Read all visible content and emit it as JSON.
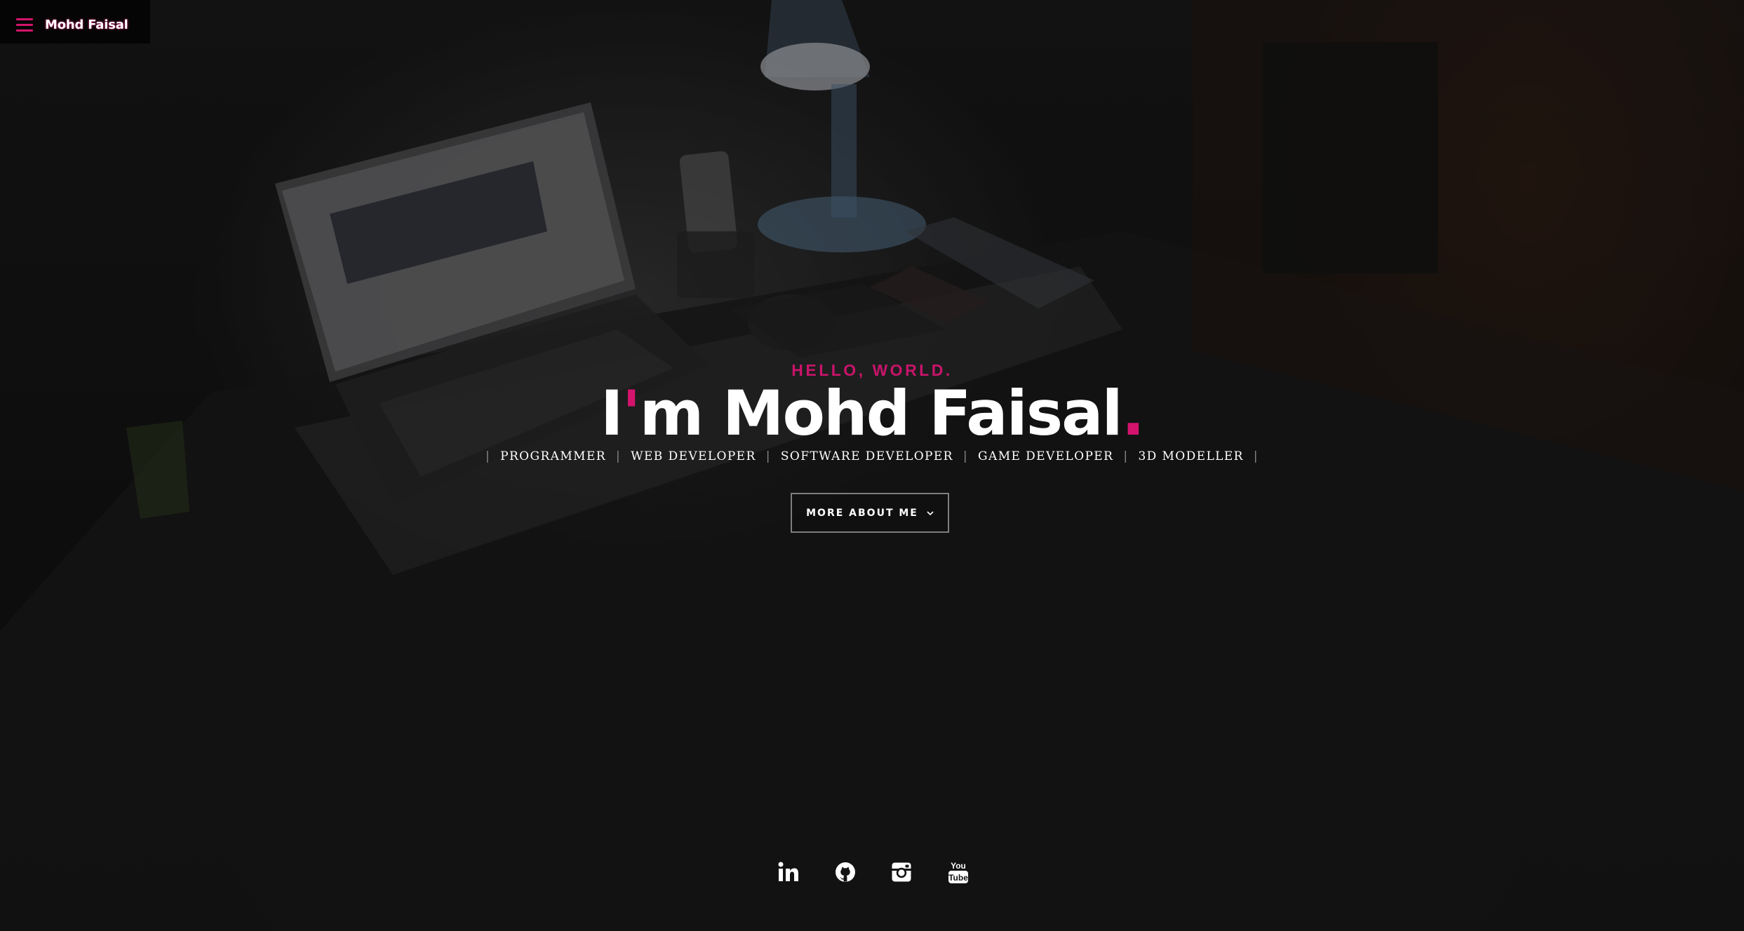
{
  "nav": {
    "brand": "Mohd Faisal",
    "menu_icon": "hamburger-menu-icon",
    "accent_color": "#d4146c"
  },
  "hero": {
    "kicker": "HELLO, WORLD.",
    "title_prefix": "I",
    "title_apostrophe": "'",
    "title_main": "m Mohd Faisal",
    "title_dot": ".",
    "roles": [
      "PROGRAMMER",
      "WEB DEVELOPER",
      "SOFTWARE DEVELOPER",
      "GAME DEVELOPER",
      "3D MODELLER"
    ],
    "separator": "|",
    "cta_label": "MORE ABOUT ME",
    "cta_icon": "chevron-down-icon"
  },
  "social": {
    "icons": [
      "linkedin-icon",
      "github-icon",
      "instagram-icon",
      "youtube-icon"
    ],
    "youtube_top": "You",
    "youtube_bottom": "Tube"
  },
  "colors": {
    "accent": "#d4146c",
    "background": "#141414",
    "text": "#ffffff"
  }
}
